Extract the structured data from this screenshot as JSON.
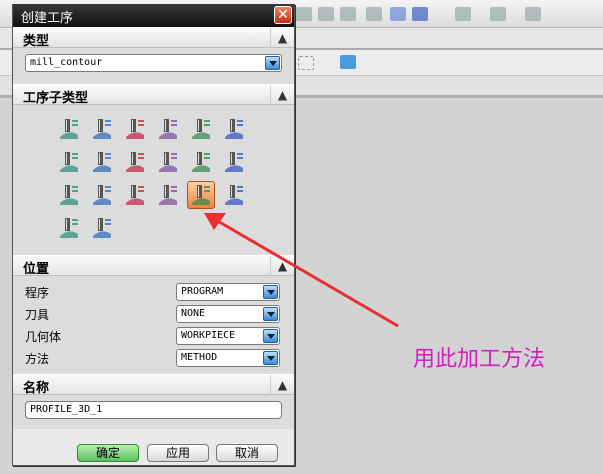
{
  "dialog": {
    "title": "创建工序"
  },
  "type_section": {
    "header": "类型",
    "value": "mill_contour"
  },
  "subtype_section": {
    "header": "工序子类型",
    "icons": [
      "cavity-mill-icon",
      "plunge-milling-icon",
      "corner-rough-icon",
      "rest-milling-icon",
      "zlevel-profile-icon",
      "zlevel-corner-icon",
      "fixed-contour-icon",
      "contour-area-icon",
      "contour-surface-area-icon",
      "streamline-icon",
      "contour-area-non-steep-icon",
      "contour-area-dir-steep-icon",
      "flowcut-single-icon",
      "flowcut-multiple-icon",
      "flowcut-ref-tool-icon",
      "solid-profile-3d-icon",
      "profile-3d-icon",
      "contour-text-icon",
      "mill-user-icon",
      "mill-control-icon"
    ],
    "selected": "profile-3d-icon"
  },
  "location_section": {
    "header": "位置",
    "rows": [
      {
        "label": "程序",
        "value": "PROGRAM"
      },
      {
        "label": "刀具",
        "value": "NONE"
      },
      {
        "label": "几何体",
        "value": "WORKPIECE"
      },
      {
        "label": "方法",
        "value": "METHOD"
      }
    ]
  },
  "name_section": {
    "header": "名称",
    "value": "PROFILE_3D_1"
  },
  "buttons": {
    "ok": "确定",
    "apply": "应用",
    "cancel": "取消"
  },
  "annotation": {
    "text": "用此加工方法",
    "color": "#d020c0",
    "arrow_color": "#e83030"
  }
}
